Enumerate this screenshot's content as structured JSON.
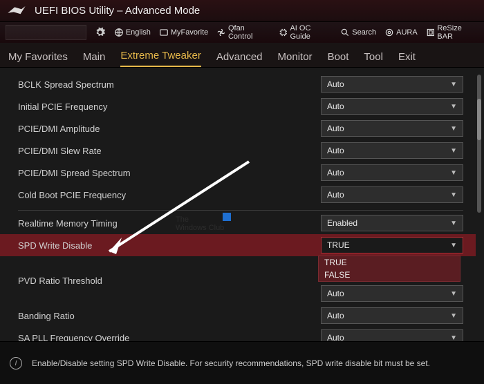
{
  "header": {
    "title": "UEFI BIOS Utility – Advanced Mode"
  },
  "toolbar": {
    "language": "English",
    "favorite": "MyFavorite",
    "qfan": "Qfan Control",
    "aioc": "AI OC Guide",
    "search": "Search",
    "aura": "AURA",
    "resize": "ReSize BAR"
  },
  "tabs": [
    {
      "id": "fav",
      "label": "My Favorites"
    },
    {
      "id": "main",
      "label": "Main"
    },
    {
      "id": "extreme",
      "label": "Extreme Tweaker"
    },
    {
      "id": "advanced",
      "label": "Advanced"
    },
    {
      "id": "monitor",
      "label": "Monitor"
    },
    {
      "id": "boot",
      "label": "Boot"
    },
    {
      "id": "tool",
      "label": "Tool"
    },
    {
      "id": "exit",
      "label": "Exit"
    }
  ],
  "rows": {
    "bclk": {
      "label": "BCLK Spread Spectrum",
      "value": "Auto"
    },
    "ipcie": {
      "label": "Initial PCIE Frequency",
      "value": "Auto"
    },
    "pcieamp": {
      "label": "PCIE/DMI Amplitude",
      "value": "Auto"
    },
    "pcieslew": {
      "label": "PCIE/DMI Slew Rate",
      "value": "Auto"
    },
    "pciess": {
      "label": "PCIE/DMI Spread Spectrum",
      "value": "Auto"
    },
    "coldboot": {
      "label": "Cold Boot PCIE Frequency",
      "value": "Auto"
    },
    "realtime": {
      "label": "Realtime Memory Timing",
      "value": "Enabled"
    },
    "spd": {
      "label": "SPD Write Disable",
      "value": "TRUE"
    },
    "pvd": {
      "label": "PVD Ratio Threshold",
      "value": "Auto"
    },
    "banding": {
      "label": "Banding Ratio",
      "value": "Auto"
    },
    "sapll": {
      "label": "SA PLL Frequency Override",
      "value": "Auto"
    }
  },
  "dropdown": {
    "opt1": "TRUE",
    "opt2": "FALSE"
  },
  "help": "Enable/Disable setting SPD Write Disable. For security recommendations, SPD write disable bit must be set."
}
